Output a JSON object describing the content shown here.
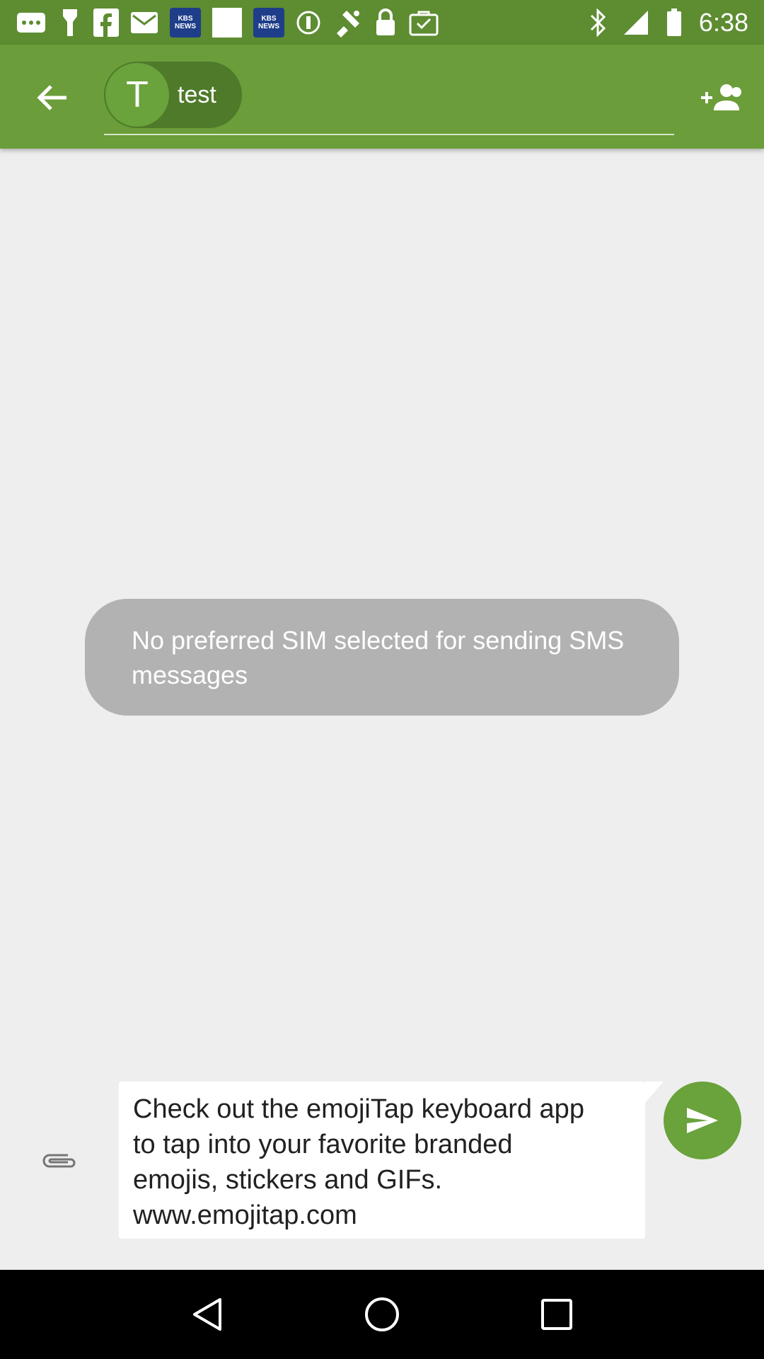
{
  "status_bar": {
    "time": "6:38",
    "icons_left": [
      "more-dots-icon",
      "torch-icon",
      "facebook-icon",
      "mail-icon",
      "kbs-news-icon",
      "blank-notification-icon",
      "kbs-news-icon",
      "circle-info-icon",
      "fake-gps-icon",
      "lock-icon",
      "task-icon"
    ],
    "kbs_label_1": "KBS",
    "kbs_label_2": "NEWS",
    "icons_right": [
      "bluetooth-icon",
      "signal-icon",
      "battery-icon"
    ]
  },
  "app_bar": {
    "recipient_initial": "T",
    "recipient_name": "test",
    "colors": {
      "bar": "#6b9d3a",
      "status": "#5d8c31",
      "chip": "#4f7a2a",
      "avatar": "#6aa23b"
    }
  },
  "conversation": {
    "info_message": "No preferred SIM selected for sending SMS messages"
  },
  "compose": {
    "text": "Check out the emojiTap keyboard app\nto tap into your favorite branded\nemojis, stickers and GIFs.\nwww.emojitap.com",
    "send_color": "#6aa23b"
  },
  "nav": {
    "buttons": [
      "back-triangle-icon",
      "home-circle-icon",
      "recents-square-icon"
    ]
  }
}
